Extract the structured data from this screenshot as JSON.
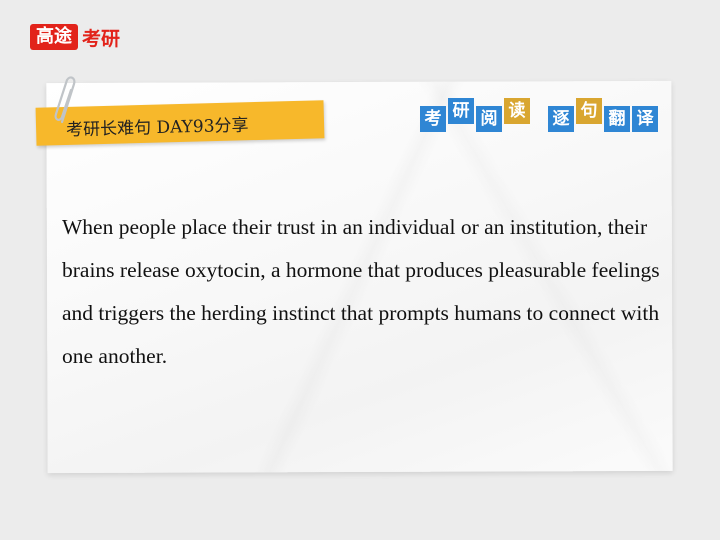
{
  "logo": {
    "box_text": "高途",
    "text": "考研"
  },
  "tag": {
    "label": "考研长难句 DAY93分享"
  },
  "badges": {
    "left": [
      "考",
      "研",
      "阅",
      "读"
    ],
    "right": [
      "逐",
      "句",
      "翻",
      "译"
    ]
  },
  "sentence": {
    "text": "When people place their trust in an individual or an institution, their brains release oxytocin, a hormone that produces pleasurable feelings and triggers the herding instinct that prompts humans to connect with one another."
  },
  "colors": {
    "brand_red": "#e2231a",
    "tag_yellow": "#f7b82b",
    "badge_blue": "#2f86d4",
    "badge_gold": "#d9a630"
  },
  "icons": {
    "clip": "paperclip-icon"
  }
}
